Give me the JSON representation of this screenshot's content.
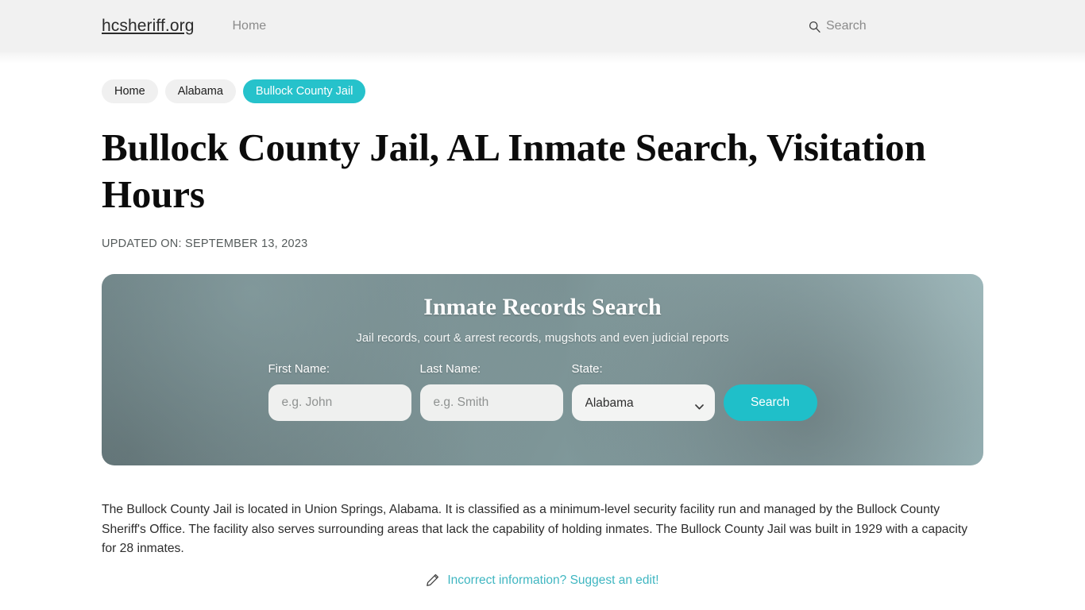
{
  "header": {
    "brand": "hcsheriff.org",
    "nav": [
      {
        "label": "Home"
      }
    ],
    "search": {
      "icon": "search-icon",
      "label": "Search"
    }
  },
  "breadcrumbs": [
    {
      "label": "Home",
      "active": false
    },
    {
      "label": "Alabama",
      "active": false
    },
    {
      "label": "Bullock County Jail",
      "active": true
    }
  ],
  "article": {
    "title": "Bullock County Jail, AL Inmate Search, Visitation Hours",
    "updated_on": "UPDATED ON: SEPTEMBER 13, 2023",
    "paragraph_lead": "The Bullock County Jail",
    "paragraph_rest": " is located in Union Springs, Alabama. It is classified as a minimum-level security facility run and managed by the Bullock County Sheriff's Office. The facility also serves surrounding areas that lack the capability of holding inmates. The Bullock County Jail was built in 1929 with a capacity for 28 inmates."
  },
  "search_panel": {
    "title": "Inmate Records Search",
    "subtitle": "Jail records, court & arrest records, mugshots and even judicial reports",
    "first_name": {
      "label": "First Name:",
      "placeholder": "e.g. John",
      "value": ""
    },
    "last_name": {
      "label": "Last Name:",
      "placeholder": "e.g. Smith",
      "value": ""
    },
    "state": {
      "label": "State:",
      "selected": "Alabama",
      "options": [
        "Alabama"
      ]
    },
    "submit_label": "Search"
  },
  "suggest_edit": {
    "icon": "pencil-icon",
    "label": "Incorrect information? Suggest an edit!"
  },
  "colors": {
    "accent_teal": "#26c2cb",
    "button_teal": "#1fbfc9",
    "link_teal": "#3fb6c1",
    "topbar_bg": "#f1f1f1",
    "crumb_bg": "#f0f0f0",
    "panel_bg": "#7e9698",
    "input_bg": "#eff0ef",
    "page_bg": "#ffffff"
  }
}
